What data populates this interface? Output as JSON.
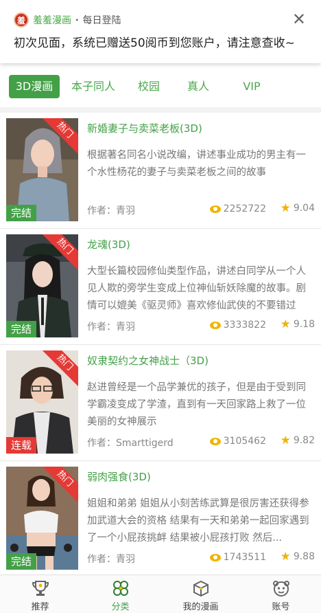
{
  "notice": {
    "app_name": "羞羞漫画",
    "separator": "•",
    "subtitle": "每日登陆",
    "close_glyph": "✕",
    "message": "初次见面，系统已赠送50阅币到您账户，请注意查收~",
    "logo_char": "羞",
    "logo_icon": "red-round-app-logo"
  },
  "tabs": [
    {
      "label": "3D漫画",
      "active": true
    },
    {
      "label": "本子同人",
      "active": false
    },
    {
      "label": "校园",
      "active": false
    },
    {
      "label": "真人",
      "active": false
    },
    {
      "label": "VIP",
      "active": false
    }
  ],
  "comics": [
    {
      "title": "新婚妻子与卖菜老板(3D)",
      "description": "根据著名同名小说改编，讲述事业成功的男主有一个水性杨花的妻子与卖菜老板之间的故事",
      "author": "作者：青羽",
      "views": "2252722",
      "rating": "9.04",
      "hot_tag": "热门",
      "status": "完结",
      "status_color": "#43a047"
    },
    {
      "title": "龙魂(3D)",
      "description": "大型长篇校园修仙类型作品，讲述白同学从一个人见人欺的旁学生变成上位神仙斩妖除魔的故事。剧情可以媲美《驱灵师》喜欢修仙武侠的不要错过",
      "author": "作者：青羽",
      "views": "3333822",
      "rating": "9.18",
      "hot_tag": "热门",
      "status": "完结",
      "status_color": "#43a047"
    },
    {
      "title": "奴隶契约之女神战士（3D)",
      "description": "赵进曾经是一个品学兼优的孩子，但是由于受到同学霸凌变成了学渣，直到有一天回家路上救了一位美丽的女神展示",
      "author": "作者：Smarttigerd",
      "views": "3105462",
      "rating": "9.82",
      "hot_tag": "热门",
      "status": "连载",
      "status_color": "#e53935"
    },
    {
      "title": "弱肉强食(3D)",
      "description": "姐姐和弟弟 姐姐从小刻苦练武算是很厉害还获得参加武道大会的资格 结果有一天和弟弟一起回家遇到了一个小屁孩挑衅 结果被小屁孩打败 然后...",
      "author": "作者：青羽",
      "views": "1743511",
      "rating": "9.88",
      "hot_tag": "热门",
      "status": "完结",
      "status_color": "#43a047"
    }
  ],
  "bottom_nav": [
    {
      "label": "推荐",
      "icon": "trophy-icon",
      "active": false
    },
    {
      "label": "分类",
      "icon": "clover-icon",
      "active": true
    },
    {
      "label": "我的漫画",
      "icon": "box-icon",
      "active": false
    },
    {
      "label": "账号",
      "icon": "face-icon",
      "active": false
    }
  ],
  "colors": {
    "accent": "#43a047",
    "hot": "#e53935",
    "icon_yellow": "#f0b400"
  }
}
